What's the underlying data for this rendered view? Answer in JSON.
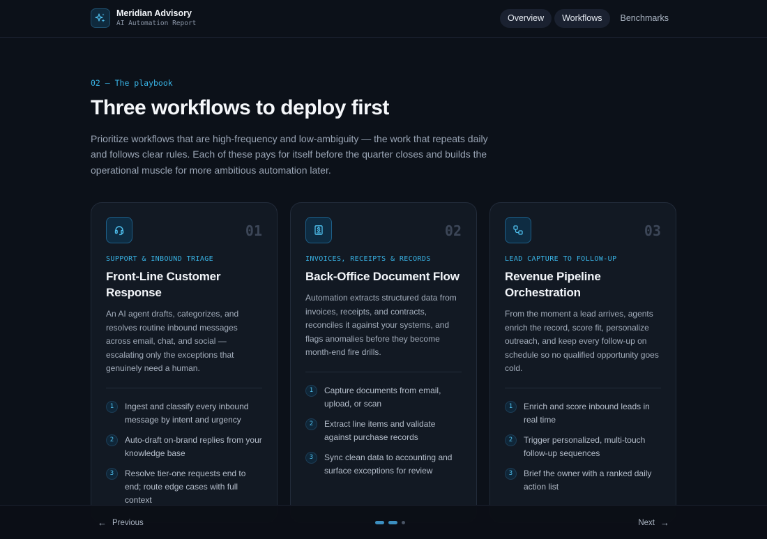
{
  "header": {
    "brand_name": "Meridian Advisory",
    "brand_sub": "AI Automation Report",
    "brand_icon": "sparkle-icon",
    "nav": [
      {
        "label": "Overview"
      },
      {
        "label": "Workflows"
      },
      {
        "label": "Benchmarks"
      }
    ]
  },
  "hero": {
    "eyebrow": "02 — The playbook",
    "title": "Three workflows to deploy first",
    "lede": "Prioritize workflows that are high-frequency and low-ambiguity — the work that repeats daily and follows clear rules. Each of these pays for itself before the quarter closes and builds the operational muscle for more ambitious automation later."
  },
  "cards": [
    {
      "num": "01",
      "icon": "headset-icon",
      "category": "SUPPORT & INBOUND TRIAGE",
      "title": "Front-Line Customer Response",
      "desc": "An AI agent drafts, categorizes, and resolves routine inbound messages across email, chat, and social — escalating only the exceptions that genuinely need a human.",
      "steps": [
        {
          "n": "1",
          "text": "Ingest and classify every inbound message by intent and urgency"
        },
        {
          "n": "2",
          "text": "Auto-draft on-brand replies from your knowledge base"
        },
        {
          "n": "3",
          "text": "Resolve tier-one requests end to end; route edge cases with full context"
        }
      ]
    },
    {
      "num": "02",
      "icon": "document-dollar-icon",
      "category": "INVOICES, RECEIPTS & RECORDS",
      "title": "Back-Office Document Flow",
      "desc": "Automation extracts structured data from invoices, receipts, and contracts, reconciles it against your systems, and flags anomalies before they become month-end fire drills.",
      "steps": [
        {
          "n": "1",
          "text": "Capture documents from email, upload, or scan"
        },
        {
          "n": "2",
          "text": "Extract line items and validate against purchase records"
        },
        {
          "n": "3",
          "text": "Sync clean data to accounting and surface exceptions for review"
        }
      ]
    },
    {
      "num": "03",
      "icon": "workflow-icon",
      "category": "LEAD CAPTURE TO FOLLOW-UP",
      "title": "Revenue Pipeline Orchestration",
      "desc": "From the moment a lead arrives, agents enrich the record, score fit, personalize outreach, and keep every follow-up on schedule so no qualified opportunity goes cold.",
      "steps": [
        {
          "n": "1",
          "text": "Enrich and score inbound leads in real time"
        },
        {
          "n": "2",
          "text": "Trigger personalized, multi-touch follow-up sequences"
        },
        {
          "n": "3",
          "text": "Brief the owner with a ranked daily action list"
        }
      ]
    }
  ],
  "footer": {
    "prev_label": "Previous",
    "next_label": "Next",
    "current_page": 2,
    "total_pages": 3
  },
  "colors": {
    "accent": "#39b4e6",
    "background": "#0c1119",
    "card": "#121923"
  }
}
